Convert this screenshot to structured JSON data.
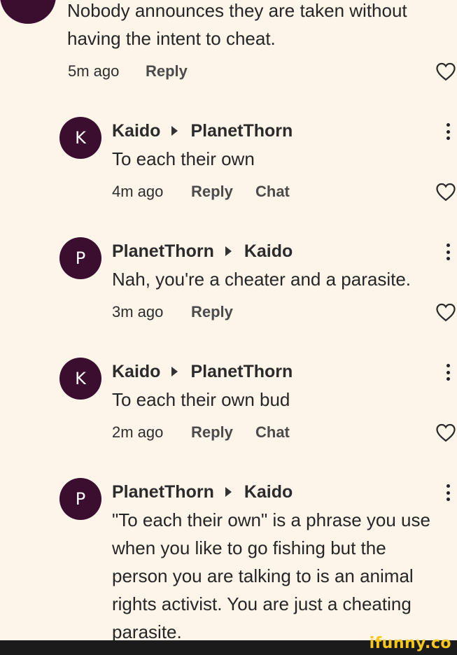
{
  "top_comment": {
    "text_lines": [
      "Nobody announces they are taken without",
      "having the intent to cheat."
    ],
    "time": "5m ago",
    "reply_label": "Reply"
  },
  "replies": [
    {
      "avatar_letter": "K",
      "author": "Kaido",
      "recipient": "PlanetThorn",
      "text_lines": [
        "To each their own"
      ],
      "time": "4m ago",
      "reply_label": "Reply",
      "chat_label": "Chat"
    },
    {
      "avatar_letter": "P",
      "author": "PlanetThorn",
      "recipient": "Kaido",
      "text_lines": [
        "Nah, you're a cheater and a parasite."
      ],
      "time": "3m ago",
      "reply_label": "Reply"
    },
    {
      "avatar_letter": "K",
      "author": "Kaido",
      "recipient": "PlanetThorn",
      "text_lines": [
        "To each their own bud"
      ],
      "time": "2m ago",
      "reply_label": "Reply",
      "chat_label": "Chat"
    },
    {
      "avatar_letter": "P",
      "author": "PlanetThorn",
      "recipient": "Kaido",
      "text_lines": [
        "\"To each their own\" is a phrase you use",
        "when you like to go fishing but the",
        "person you are talking to is an animal",
        "rights activist. You are just a cheating",
        "parasite."
      ]
    }
  ],
  "watermark": "ifunny.co",
  "colors": {
    "background": "#fdf4ea",
    "avatar": "#3b0d2e",
    "watermark": "#f5c71a",
    "footer": "#1b1b1b"
  }
}
